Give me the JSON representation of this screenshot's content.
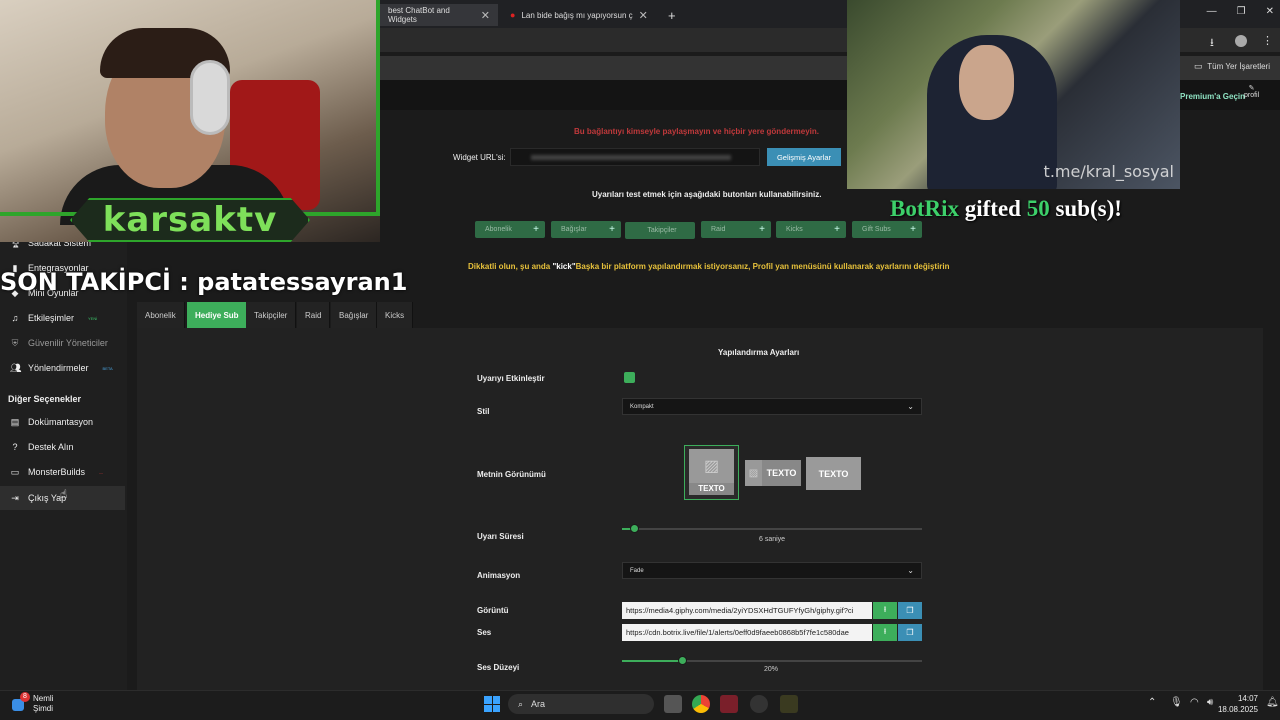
{
  "browser": {
    "tabs": [
      {
        "label": "best ChatBot and Widgets"
      },
      {
        "label": "Lan bide bağış mı yapıyorsun ç"
      }
    ],
    "new_tab": "+",
    "bookmarks_label": "Tüm Yer İşaretleri",
    "premium_label": "Premium'a Geçin",
    "profile_label": "profil"
  },
  "page": {
    "warning": "Bu bağlantıyı kimseyle paylaşmayın ve hiçbir yere göndermeyin.",
    "widget_url_label": "Widget URL'si:",
    "advanced_button": "Gelişmiş Ayarlar",
    "test_note": "Uyarıları test etmek için aşağıdaki butonları kullanabilirsiniz.",
    "test_buttons": [
      "Abonelik",
      "Bağışlar",
      "Takipçiler",
      "Raid",
      "Kicks",
      "Gift Subs"
    ],
    "platform_note_prefix": "Dikkatli olun, şu anda ",
    "platform_note_platform": "\"kick\"",
    "platform_note_suffix": "Başka bir platform yapılandırmak istiyorsanız, Profil yan menüsünü kullanarak ayarlarını değiştirin",
    "tabs": [
      "Abonelik",
      "Hediye Sub",
      "Takipçiler",
      "Raid",
      "Bağışlar",
      "Kicks"
    ],
    "active_tab": "Hediye Sub"
  },
  "sidebar": {
    "items": [
      {
        "label": "Sadakat Sistem",
        "icon": "trophy-icon"
      },
      {
        "label": "Entegrasyonlar",
        "icon": "plug-icon"
      },
      {
        "label": "Mini Oyunlar",
        "icon": "gamepad-icon"
      },
      {
        "label": "Etkileşimler",
        "icon": "music-icon",
        "badge": "YENİ"
      },
      {
        "label": "Güvenilir Yöneticiler",
        "icon": "shield-icon"
      },
      {
        "label": "Yönlendirmeler",
        "icon": "users-icon",
        "badge": "BETA"
      }
    ],
    "section_title": "Diğer Seçenekler",
    "other_items": [
      {
        "label": "Dokümantasyon",
        "icon": "book-icon"
      },
      {
        "label": "Destek Alın",
        "icon": "help-icon"
      },
      {
        "label": "MonsterBuilds",
        "icon": "laptop-icon",
        "badge": "—"
      },
      {
        "label": "Çıkış Yap",
        "icon": "logout-icon"
      }
    ]
  },
  "config": {
    "title": "Yapılandırma Ayarları",
    "enable_label": "Uyarıyı Etkinleştir",
    "enable_checked": true,
    "style_label": "Stil",
    "style_value": "Kompakt",
    "text_view_label": "Metnin Görünümü",
    "text_view_options": [
      "TEXTO",
      "TEXTO",
      "TEXTO"
    ],
    "text_view_selected": 0,
    "duration_label": "Uyarı Süresi",
    "duration_value": "6 saniye",
    "duration_fraction": 0.04,
    "animation_label": "Animasyon",
    "animation_value": "Fade",
    "image_label": "Görüntü",
    "image_url": "https://media4.giphy.com/media/2yiYDSXHdTGUFYfyGh/giphy.gif?ci",
    "sound_label": "Ses",
    "sound_url": "https://cdn.botrix.live/file/1/alerts/0eff0d9faeeb0868b5f7fe1c580dae",
    "volume_label": "Ses Düzeyi",
    "volume_value": "20%",
    "volume_fraction": 0.2
  },
  "overlay": {
    "streamer_name": "karsaktv",
    "follower_banner": "SON TAKİPCİ : patatessayran1",
    "video_watermark": "t.me/kral_sosyal",
    "gift_sender": "BotRix",
    "gift_mid": " gifted ",
    "gift_count": "50",
    "gift_suffix": " sub(s)!"
  },
  "taskbar": {
    "notif_count": "8",
    "notif_title": "Nemli",
    "notif_sub": "Şimdi",
    "search_label": "Ara",
    "time": "14:07",
    "date": "18.08.2025"
  },
  "colors": {
    "accent": "#3dae5b",
    "warning": "#c0393b",
    "note": "#e7c13b",
    "overlay_green": "#2ea52b"
  }
}
